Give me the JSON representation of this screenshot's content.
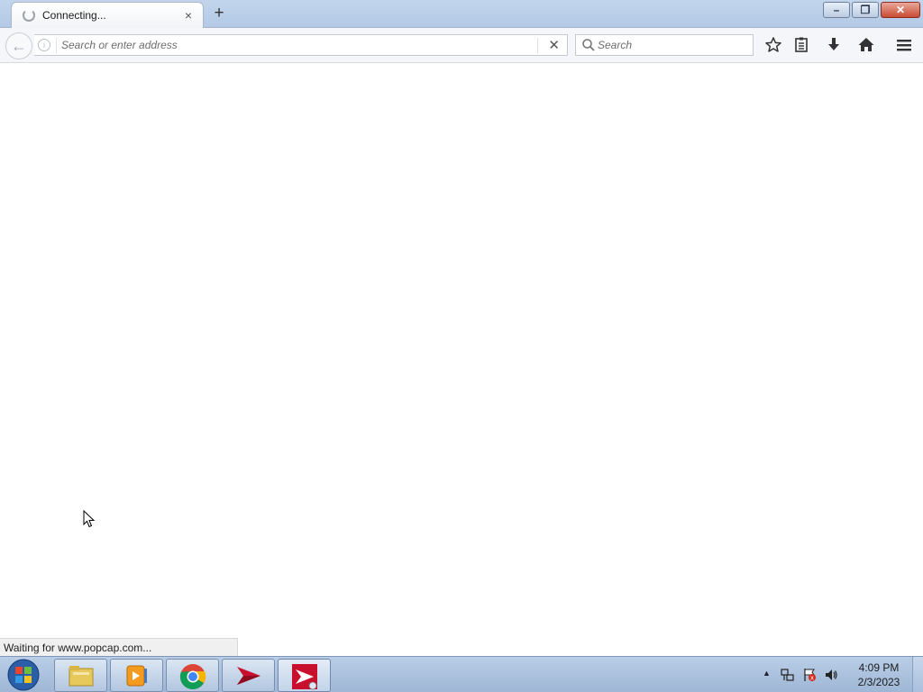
{
  "browser": {
    "tab": {
      "title": "Connecting...",
      "close_glyph": "×"
    },
    "new_tab_glyph": "+",
    "window_controls": {
      "minimize": "–",
      "restore": "❐",
      "close": "✕"
    },
    "nav": {
      "back_glyph": "←",
      "info_glyph": "i",
      "address_placeholder": "Search or enter address",
      "address_value": "",
      "clear_glyph": "✕",
      "search_placeholder": "Search"
    },
    "status_text": "Waiting for www.popcap.com..."
  },
  "taskbar": {
    "apps": [
      "file-explorer-icon",
      "media-player-icon",
      "chrome-icon",
      "red-arrow-app-icon",
      "red-arrow-web-app-icon"
    ],
    "clock": {
      "time": "4:09 PM",
      "date": "2/3/2023"
    },
    "tray_arrow": "▲"
  },
  "colors": {
    "accent_red": "#c8102e",
    "taskbar": "#a9bfdc",
    "tab_bar": "#bcd0ea"
  }
}
